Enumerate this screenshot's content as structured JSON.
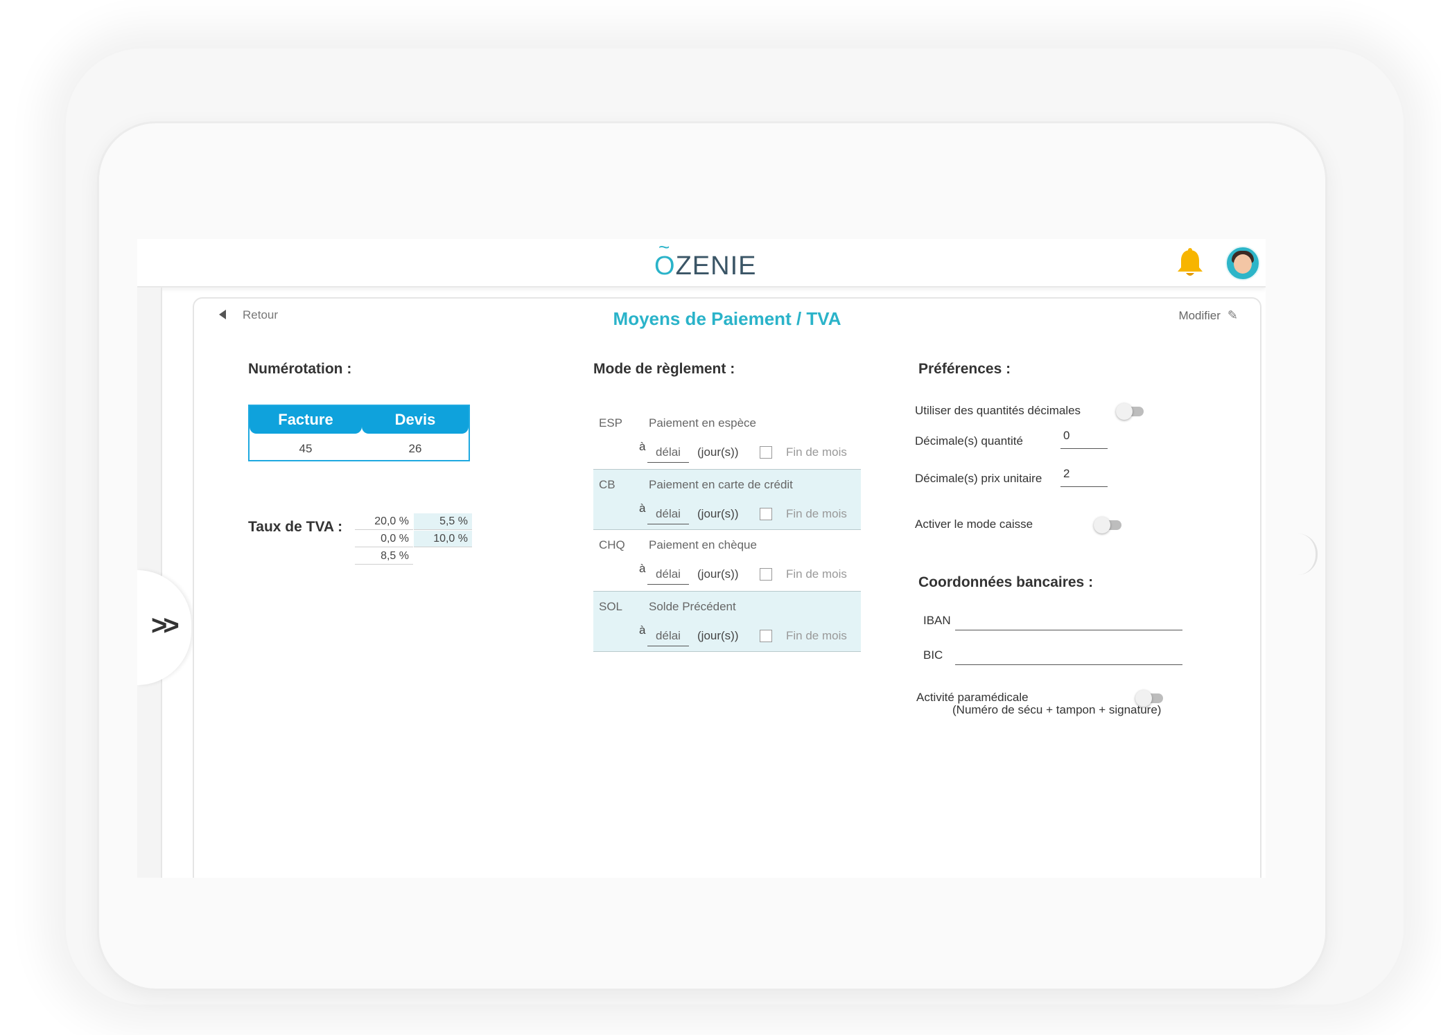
{
  "app": {
    "logo_text": "ZENIE",
    "logo_letter": "O"
  },
  "header": {
    "back_label": "Retour",
    "title": "Moyens de Paiement / TVA",
    "edit_label": "Modifier"
  },
  "numerotation": {
    "title": "Numérotation :",
    "facture_label": "Facture",
    "devis_label": "Devis",
    "facture_value": "45",
    "devis_value": "26"
  },
  "tva": {
    "title": "Taux de TVA :",
    "rates": [
      "20,0 %",
      "5,5 %",
      "0,0 %",
      "10,0 %",
      "8,5 %"
    ]
  },
  "reglement": {
    "title": "Mode de règlement :",
    "a_label": "à",
    "delai_label": "délai",
    "jours_label": "(jour(s))",
    "fin_label": "Fin de mois",
    "modes": [
      {
        "code": "ESP",
        "name": "Paiement en espèce"
      },
      {
        "code": "CB",
        "name": "Paiement en carte de crédit"
      },
      {
        "code": "CHQ",
        "name": "Paiement en chèque"
      },
      {
        "code": "SOL",
        "name": "Solde Précédent"
      }
    ]
  },
  "preferences": {
    "title": "Préférences :",
    "decimal_qty_label": "Utiliser des quantités décimales",
    "decimal_qty_count_label": "Décimale(s) quantité",
    "decimal_qty_count_value": "0",
    "decimal_price_label": "Décimale(s) prix unitaire",
    "decimal_price_value": "2",
    "caisse_label": "Activer le mode caisse"
  },
  "bank": {
    "title": "Coordonnées bancaires :",
    "iban_label": "IBAN",
    "bic_label": "BIC",
    "paramedical_label": "Activité paramédicale",
    "paramedical_sub": "(Numéro de sécu + tampon + signature)"
  },
  "colors": {
    "accent": "#2ab3c9",
    "table_blue": "#0fa2dc",
    "row_shade": "#e3f3f6",
    "bell": "#f7b500"
  },
  "icons": {
    "bell": "bell-icon",
    "back": "triangle-left-icon",
    "edit": "pencil-icon",
    "expand": "double-chevron-right-icon"
  }
}
